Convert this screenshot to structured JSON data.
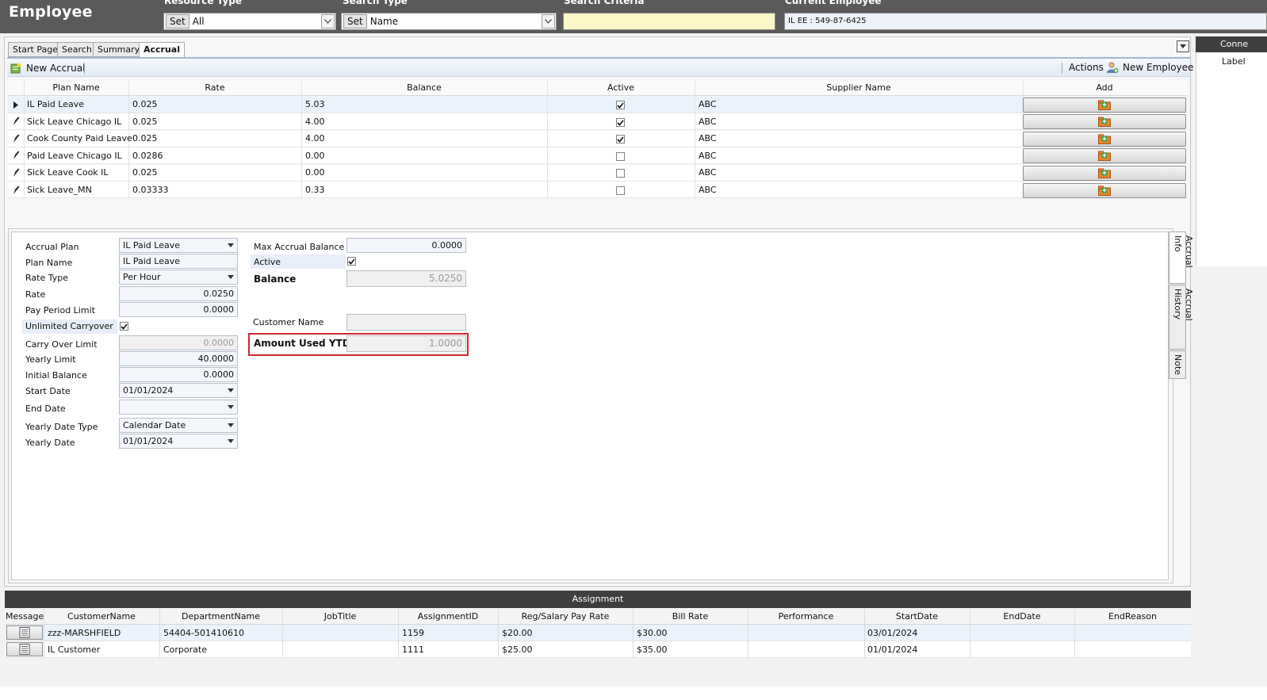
{
  "header": {
    "title": "Employee",
    "resource_type_label": "Resource Type",
    "resource_type_value": "All",
    "search_type_label": "Search Type",
    "search_type_value": "Name",
    "set_label": "Set",
    "search_criteria_label": "Search Criteria",
    "search_criteria_value": "",
    "current_employee_label": "Current Employee",
    "current_employee_value": "IL  EE : 549-87-6425"
  },
  "tabs": [
    "Start Page",
    "Search",
    "Summary",
    "Accrual"
  ],
  "active_tab": "Accrual",
  "toolbar": {
    "new_accrual": "New Accrual",
    "actions": "Actions",
    "new_employee": "New Employee"
  },
  "grid": {
    "columns": [
      "Plan Name",
      "Rate",
      "Balance",
      "Active",
      "Supplier Name",
      "Add"
    ],
    "rows": [
      {
        "plan": "IL Paid Leave",
        "rate": "0.025",
        "balance": "5.03",
        "active": true,
        "supplier": "ABC"
      },
      {
        "plan": "Sick Leave Chicago IL",
        "rate": "0.025",
        "balance": "4.00",
        "active": true,
        "supplier": "ABC"
      },
      {
        "plan": "Cook County Paid Leave",
        "rate": "0.025",
        "balance": "4.00",
        "active": true,
        "supplier": "ABC"
      },
      {
        "plan": "Paid Leave Chicago IL",
        "rate": "0.0286",
        "balance": "0.00",
        "active": false,
        "supplier": "ABC"
      },
      {
        "plan": "Sick Leave Cook IL",
        "rate": "0.025",
        "balance": "0.00",
        "active": false,
        "supplier": "ABC"
      },
      {
        "plan": "Sick Leave_MN",
        "rate": "0.03333",
        "balance": "0.33",
        "active": false,
        "supplier": "ABC"
      }
    ]
  },
  "form": {
    "accrual_plan_label": "Accrual Plan",
    "accrual_plan": "IL Paid Leave",
    "plan_name_label": "Plan Name",
    "plan_name": "IL Paid Leave",
    "rate_type_label": "Rate Type",
    "rate_type": "Per Hour",
    "rate_label": "Rate",
    "rate": "0.0250",
    "pay_period_limit_label": "Pay Period Limit",
    "pay_period_limit": "0.0000",
    "unlimited_carryover_label": "Unlimited Carryover",
    "unlimited_carryover": true,
    "carry_over_limit_label": "Carry Over Limit",
    "carry_over_limit": "0.0000",
    "yearly_limit_label": "Yearly Limit",
    "yearly_limit": "40.0000",
    "initial_balance_label": "Initial Balance",
    "initial_balance": "0.0000",
    "start_date_label": "Start Date",
    "start_date": "01/01/2024",
    "end_date_label": "End Date",
    "end_date": "",
    "yearly_date_type_label": "Yearly Date Type",
    "yearly_date_type": "Calendar Date",
    "yearly_date_label": "Yearly Date",
    "yearly_date": "01/01/2024",
    "max_accrual_balance_label": "Max Accrual Balance",
    "max_accrual_balance": "0.0000",
    "active_label": "Active",
    "active": true,
    "balance_label": "Balance",
    "balance": "5.0250",
    "customer_name_label": "Customer Name",
    "customer_name": "",
    "amount_used_ytd_label": "Amount Used YTD",
    "amount_used_ytd": "1.0000"
  },
  "side_tabs": [
    "Accrual Info",
    "Accrual History",
    "Note"
  ],
  "side_panel": {
    "header": "Conne",
    "label": "Label"
  },
  "assignment": {
    "title": "Assignment",
    "columns": [
      "Message",
      "CustomerName",
      "DepartmentName",
      "JobTitle",
      "AssignmentID",
      "Reg/Salary Pay Rate",
      "Bill Rate",
      "Performance",
      "StartDate",
      "EndDate",
      "EndReason"
    ],
    "rows": [
      {
        "customer": "zzz-MARSHFIELD",
        "department": "54404-501410610",
        "job_title": "",
        "assignment_id": "1159",
        "pay_rate": "$20.00",
        "bill_rate": "$30.00",
        "performance": "",
        "start_date": "03/01/2024",
        "end_date": "",
        "end_reason": ""
      },
      {
        "customer": "IL Customer",
        "department": "Corporate",
        "job_title": "",
        "assignment_id": "1111",
        "pay_rate": "$25.00",
        "bill_rate": "$35.00",
        "performance": "",
        "start_date": "01/01/2024",
        "end_date": "",
        "end_reason": ""
      }
    ]
  },
  "colors": {
    "highlight": "#d3262c",
    "header_bg": "#5a5a5a",
    "search_bg": "#fbf7c6",
    "selected_row": "#eaf3fb"
  }
}
